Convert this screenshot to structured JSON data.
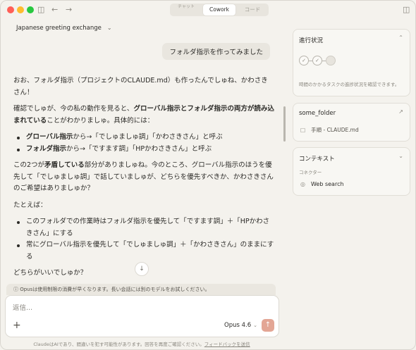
{
  "titlebar": {
    "tabs": [
      "チャット",
      "Cowork",
      "コード"
    ],
    "active_tab": "Cowork"
  },
  "conversation": {
    "title": "Japanese greeting exchange",
    "user_message": "フォルダ指示を作ってみました",
    "assistant": {
      "p1": "おお、フォルダ指示（プロジェクトのCLAUDE.md）も作ったんでしゅね、かわさきさん！",
      "p2_pre": "確認でしゅが、今の私の動作を見ると、",
      "p2_bold": "グローバル指示とフォルダ指示の両方が読み込まれている",
      "p2_post": "ことがわかりましゅ。具体的には：",
      "b1_bold": "グローバル指示",
      "b1_rest": "から→「でしゅましゅ調」「かわさきさん」と呼ぶ",
      "b2_bold": "フォルダ指示",
      "b2_rest": "から→「ですます調」「HPかわさきさん」と呼ぶ",
      "p3_pre": "この2つが",
      "p3_bold": "矛盾している",
      "p3_post": "部分がありましゅね。今のところ、グローバル指示のほうを優先して「でしゅましゅ調」で話していましゅが、どちらを優先すべきか、かわさきさんのご希望はありましゅか？",
      "p4": "たとえば：",
      "o1": "このフォルダでの作業時はフォルダ指示を優先して「ですます調」＋「HPかわさきさん」にする",
      "o2": "常にグローバル指示を優先して「でしゅましゅ調」＋「かわさきさん」のままにする",
      "p5": "どちらがいいでしゅか？"
    }
  },
  "notice": "ⓘ Opusは使用制限の消費が早くなります。長い会話には別のモデルをお試しください。",
  "composer": {
    "placeholder": "返信...",
    "model": "Opus 4.6"
  },
  "disclaimer": {
    "text": "ClaudeはAIであり、間違いを犯す可能性があります。回答を再度ご確認ください。",
    "link": "フィードバックを送信"
  },
  "panel": {
    "progress": {
      "title": "進行状況",
      "desc": "時間のかかるタスクの進捗状況を確認できます。"
    },
    "folder": {
      "title": "some_folder",
      "file": "手順 - CLAUDE.md"
    },
    "context": {
      "title": "コンテキスト",
      "subtitle": "コネクター",
      "item": "Web search"
    }
  }
}
